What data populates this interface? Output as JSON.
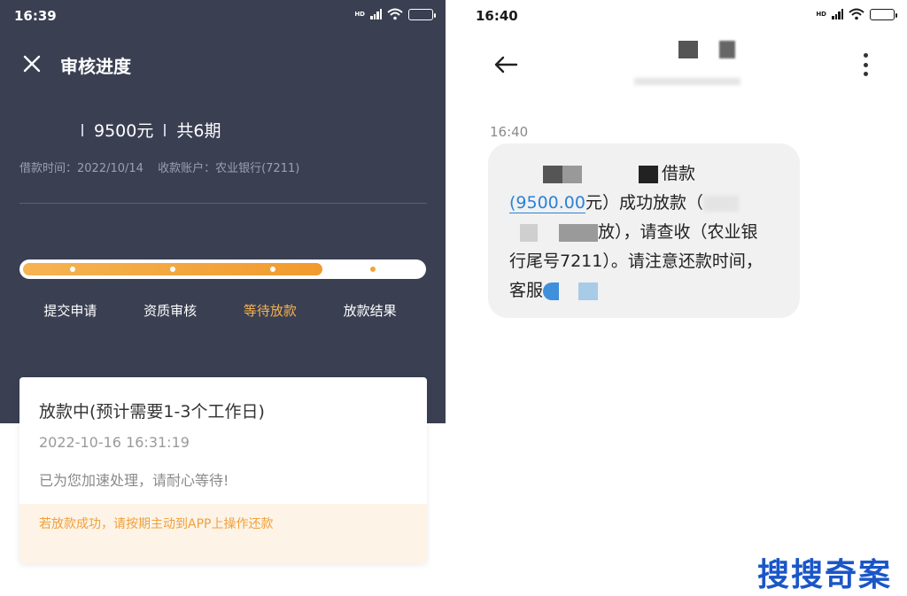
{
  "left": {
    "status_time": "16:39",
    "title": "审核进度",
    "amount": "9500元",
    "periods": "共6期",
    "loan_time_label": "借款时间：2022/10/14",
    "account_label": "收款账户：农业银行(7211)",
    "progress_fraction": 0.75,
    "steps": [
      {
        "label": "提交申请",
        "state": "done"
      },
      {
        "label": "资质审核",
        "state": "done"
      },
      {
        "label": "等待放款",
        "state": "active"
      },
      {
        "label": "放款结果",
        "state": "pending"
      }
    ],
    "card": {
      "title": "放款中(预计需要1-3个工作日)",
      "time": "2022-10-16 16:31:19",
      "note": "已为您加速处理，请耐心等待!",
      "tip": "若放款成功，请按期主动到APP上操作还款"
    }
  },
  "right": {
    "status_time": "16:40",
    "message_time": "16:40",
    "message": {
      "line1_tail": "借款",
      "amount_link": "(9500.00",
      "line2_tail": "元）成功放款（",
      "line3_tail": "放），请查收（农业银",
      "line4": "行尾号7211）。请注意还款时间，",
      "line5_head": "客服"
    }
  },
  "watermark": "搜搜奇案",
  "colors": {
    "dark_bg": "#3a3f52",
    "accent_orange": "#f4b350",
    "link_blue": "#2b82d6",
    "bubble_bg": "#f1f1f1",
    "watermark_blue": "#1a56c7"
  }
}
